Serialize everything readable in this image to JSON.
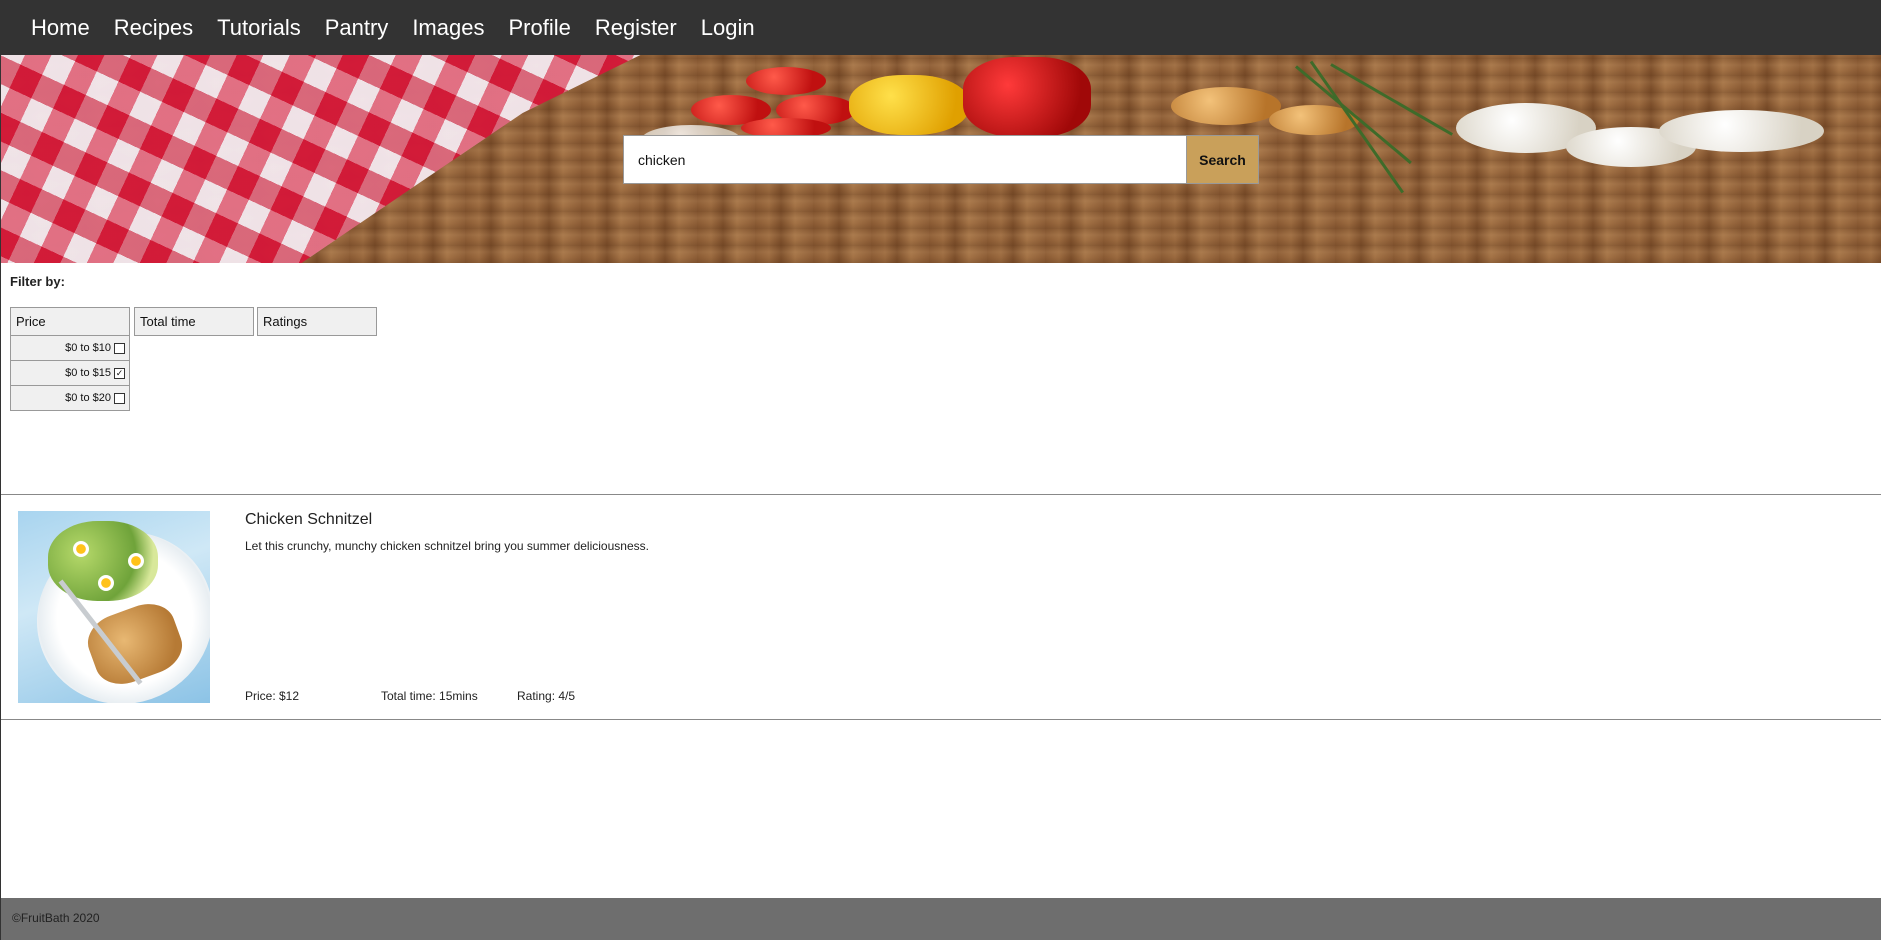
{
  "nav": {
    "items": [
      {
        "label": "Home"
      },
      {
        "label": "Recipes"
      },
      {
        "label": "Tutorials"
      },
      {
        "label": "Pantry"
      },
      {
        "label": "Images"
      },
      {
        "label": "Profile"
      },
      {
        "label": "Register"
      },
      {
        "label": "Login"
      }
    ],
    "background": "#333333"
  },
  "search": {
    "value": "chicken",
    "button_label": "Search",
    "button_color": "#c9a05a"
  },
  "filters": {
    "label": "Filter by:",
    "groups": [
      {
        "title": "Price",
        "options": [
          {
            "label": "$0 to $10",
            "checked": false
          },
          {
            "label": "$0 to $15",
            "checked": true
          },
          {
            "label": "$0 to $20",
            "checked": false
          }
        ]
      },
      {
        "title": "Total time",
        "options": []
      },
      {
        "title": "Ratings",
        "options": []
      }
    ]
  },
  "results": [
    {
      "title": "Chicken Schnitzel",
      "description": "Let this crunchy, munchy chicken schnitzel bring you summer deliciousness.",
      "price": "Price: $12",
      "total_time": "Total time: 15mins",
      "rating": "Rating: 4/5"
    }
  ],
  "footer": {
    "text": "©FruitBath 2020",
    "background": "#6e6e6e"
  }
}
